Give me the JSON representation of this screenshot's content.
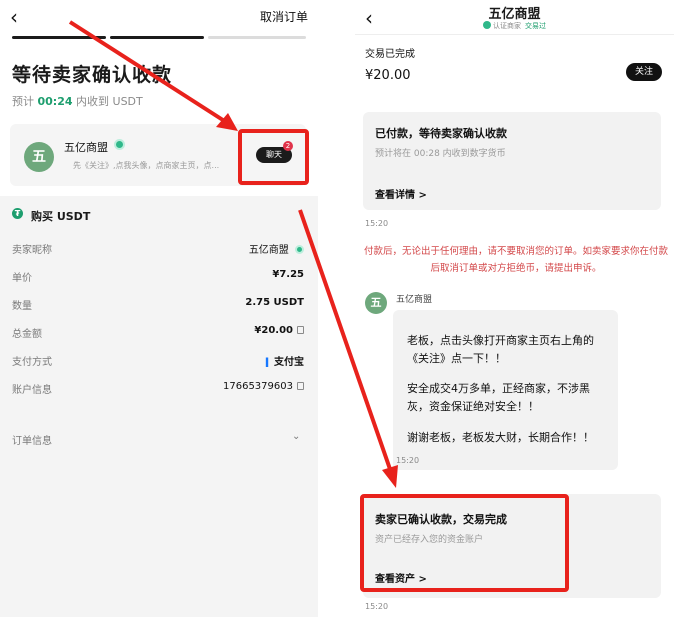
{
  "left": {
    "cancel_order": "取消订单",
    "title": "等待卖家确认收款",
    "countdown_prefix": "预计",
    "countdown_time": "00:24",
    "countdown_suffix": "内收到 USDT",
    "seller": {
      "avatar_char": "五",
      "name": "五亿商盟",
      "desc": "先《关注》,点我头像，点商家主页，点...",
      "chat_label": "聊天",
      "unread_count": "2"
    },
    "buy_label": "购买 USDT",
    "rows": [
      {
        "label": "卖家昵称",
        "value": "五亿商盟"
      },
      {
        "label": "单价",
        "value": "¥7.25"
      },
      {
        "label": "数量",
        "value": "2.75 USDT"
      },
      {
        "label": "总金额",
        "value": "¥20.00"
      },
      {
        "label": "支付方式",
        "value": "支付宝"
      },
      {
        "label": "账户信息",
        "value": "17665379603"
      }
    ],
    "order_info": "订单信息",
    "colors": {
      "accent_green": "#1d9e6e",
      "progress_active": "#1b1b1b",
      "progress_inactive": "#dcdcdc"
    }
  },
  "right": {
    "title": "五亿商盟",
    "verified_label": "认证商家",
    "trade_label": "交易过",
    "status": "交易已完成",
    "amount": "¥20.00",
    "follow_label": "关注",
    "card1": {
      "title": "已付款，等待卖家确认收款",
      "sub": "预计将在 00:28 内收到数字货币",
      "link": "查看详情 >"
    },
    "time1": "15:20",
    "warning": "付款后，无论出于任何理由，请不要取消您的订单。如卖家要求你在付款后取消订单或对方拒绝币，请提出申诉。",
    "chat_avatar": "五",
    "chat_name": "五亿商盟",
    "message_lines": [
      "老板，点击头像打开商家主页右上角的",
      "《关注》点一下！！",
      "安全成交4万多单，正经商家，不涉黑",
      "灰，资金保证绝对安全！！",
      "谢谢老板，老板发大财，长期合作！！"
    ],
    "time2": "15:20",
    "card2": {
      "title": "卖家已确认收款，交易完成",
      "sub": "资产已经存入您的资金账户",
      "link": "查看资产 >"
    },
    "time3": "15:20",
    "colors": {
      "warning_red": "#d3484a",
      "highlight_red": "#e8221c"
    }
  }
}
